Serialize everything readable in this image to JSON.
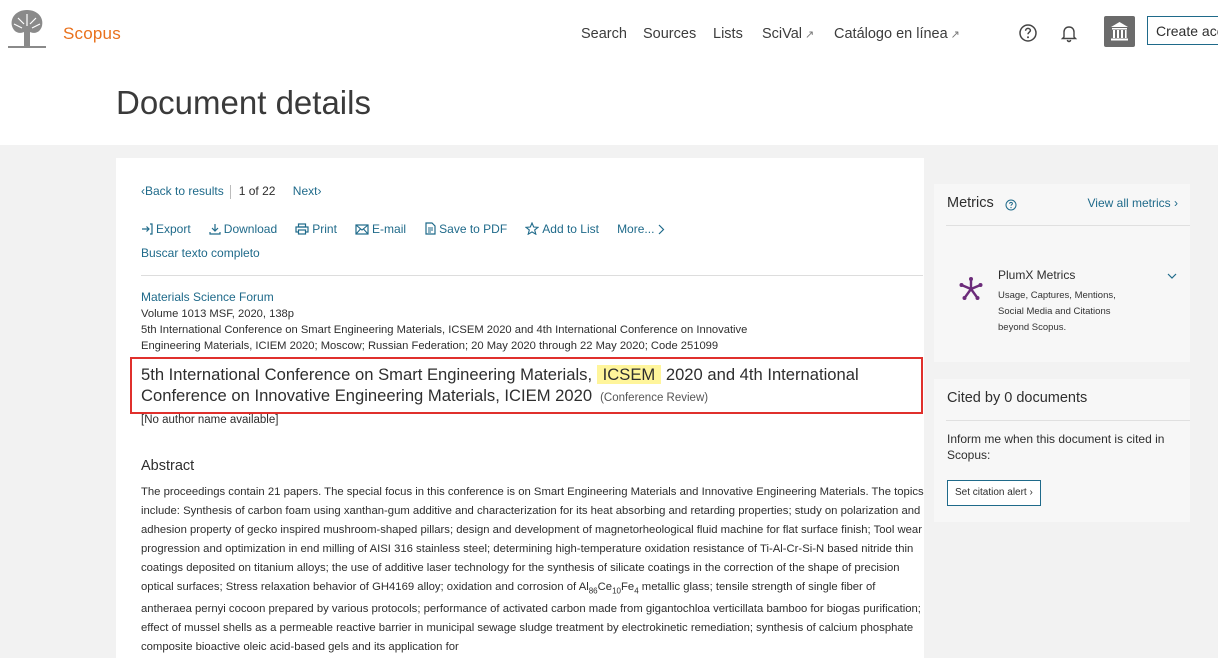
{
  "header": {
    "brand": "Scopus",
    "nav": [
      {
        "label": "Search",
        "external": false
      },
      {
        "label": "Sources",
        "external": false
      },
      {
        "label": "Lists",
        "external": false
      },
      {
        "label": "SciVal",
        "external": true
      },
      {
        "label": "Catálogo en línea",
        "external": true
      }
    ],
    "external_glyph": "↗",
    "help_icon": "question-circle-icon",
    "notification_icon": "bell-icon",
    "institution_icon": "institution-icon",
    "create_account_label": "Create acc"
  },
  "page_title": "Document details",
  "navigation": {
    "back_label": "Back to results",
    "current": "1",
    "of_label": "of",
    "total": "22",
    "next_label": "Next"
  },
  "actions": [
    {
      "label": "Export",
      "icon": "export-icon"
    },
    {
      "label": "Download",
      "icon": "download-icon"
    },
    {
      "label": "Print",
      "icon": "print-icon"
    },
    {
      "label": "E-mail",
      "icon": "email-icon"
    },
    {
      "label": "Save to PDF",
      "icon": "pdf-icon"
    },
    {
      "label": "Add to List",
      "icon": "star-icon"
    },
    {
      "label": "More...",
      "icon": "chevron-right-icon"
    }
  ],
  "full_text_link": "Buscar texto completo",
  "source": {
    "journal": "Materials Science Forum",
    "volume": "Volume 1013 MSF, 2020, 138p",
    "conference_line1": "5th International Conference on Smart Engineering Materials, ICSEM 2020 and 4th International Conference on Innovative",
    "conference_line2": "Engineering Materials, ICIEM 2020; Moscow; Russian Federation; 20 May 2020 through 22 May 2020; Code 251099"
  },
  "document": {
    "title_before": "5th International Conference on Smart Engineering Materials, ",
    "title_highlight": "ICSEM",
    "title_after": " 2020 and 4th International Conference on Innovative Engineering Materials, ICIEM 2020",
    "type": "(Conference Review)",
    "author": "[No author name available]"
  },
  "abstract": {
    "heading": "Abstract",
    "text_before_formula": "The proceedings contain 21 papers. The special focus in this conference is on Smart Engineering Materials and Innovative Engineering Materials. The topics include: Synthesis of carbon foam using xanthan-gum additive and characterization for its heat absorbing and retarding properties; study on polarization and adhesion property of gecko inspired mushroom-shaped pillars; design and development of magnetorheological fluid machine for flat surface finish; Tool wear progression and optimization in end milling of AISI 316 stainless steel; determining high-temperature oxidation resistance of Ti-Al-Cr-Si-N based nitride thin coatings deposited on titanium alloys; the use of additive laser technology for the synthesis of silicate coatings in the correction of the shape of precision optical surfaces; Stress relaxation behavior of GH4169 alloy; oxidation and corrosion of ",
    "formula": [
      {
        "t": "Al",
        "sub": false
      },
      {
        "t": "86",
        "sub": true
      },
      {
        "t": "Ce",
        "sub": false
      },
      {
        "t": "10",
        "sub": true
      },
      {
        "t": "Fe",
        "sub": false
      },
      {
        "t": "4",
        "sub": true
      }
    ],
    "text_after_formula": " metallic glass; tensile strength of single fiber of antheraea pernyi cocoon prepared by various protocols; performance of activated carbon made from gigantochloa verticillata bamboo for biogas purification; effect of mussel shells as a permeable reactive barrier in municipal sewage sludge treatment by electrokinetic remediation; synthesis of calcium phosphate composite bioactive oleic acid-based gels and its application for"
  },
  "metrics": {
    "title": "Metrics",
    "view_all": "View all metrics",
    "plumx_title": "PlumX Metrics",
    "plumx_desc": "Usage, Captures, Mentions, Social Media and Citations beyond Scopus.",
    "plumx_color": "#6c2c7a"
  },
  "cited": {
    "title": "Cited by 0 documents",
    "text": "Inform me when this document is cited in Scopus:",
    "button": "Set citation alert"
  },
  "colors": {
    "brand": "#e9711c",
    "link": "#1f6a8a",
    "highlight": "#fff59b",
    "annotation_box": "#e0302c"
  }
}
